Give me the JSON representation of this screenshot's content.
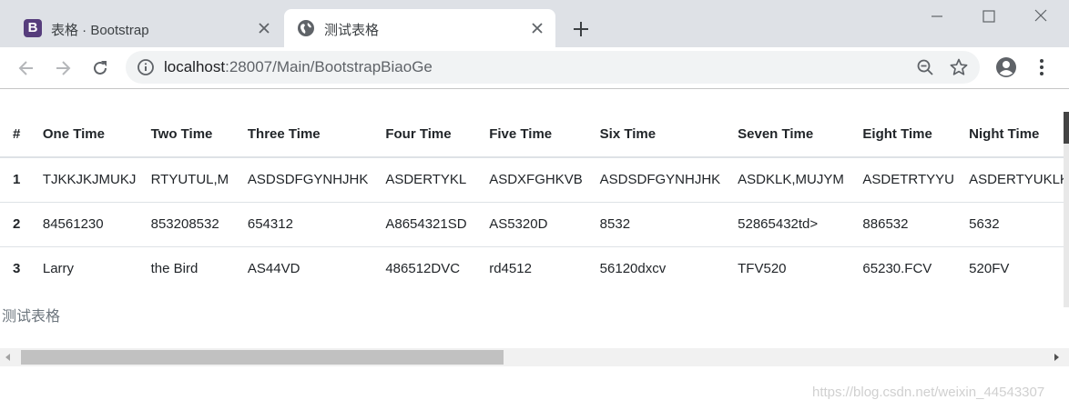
{
  "tabs": [
    {
      "title": "表格 · Bootstrap",
      "favicon": "bootstrap-logo",
      "favicon_letter": "B",
      "active": false
    },
    {
      "title": "测试表格",
      "favicon": "globe-icon",
      "active": true
    }
  ],
  "toolbar": {
    "url_host": "localhost",
    "url_path": ":28007/Main/BootstrapBiaoGe"
  },
  "table": {
    "headers": [
      "#",
      "One Time",
      "Two Time",
      "Three Time",
      "Four Time",
      "Five Time",
      "Six Time",
      "Seven Time",
      "Eight Time",
      "Night Time"
    ],
    "rows": [
      [
        "1",
        "TJKKJKJMUKJ",
        "RTYUTUL,M",
        "ASDSDFGYNHJHK",
        "ASDERTYKL",
        "ASDXFGHKVB",
        "ASDSDFGYNHJHK",
        "ASDKLK,MUJYM",
        "ASDETRTYYU",
        "ASDERTYUKLK"
      ],
      [
        "2",
        "84561230",
        "853208532",
        "654312",
        "A8654321SD",
        "AS5320D",
        "8532",
        "52865432td>",
        "886532",
        "5632"
      ],
      [
        "3",
        "Larry",
        "the Bird",
        "AS44VD",
        "486512DVC",
        "rd4512",
        "56120dxcv",
        "TFV520",
        "65230.FCV",
        "520FV"
      ]
    ]
  },
  "caption": "测试表格",
  "watermark": "https://blog.csdn.net/weixin_44543307",
  "colors": {
    "tab_strip": "#dee1e6",
    "bootstrap_purple": "#563d7c",
    "omnibox": "#f1f3f4"
  }
}
